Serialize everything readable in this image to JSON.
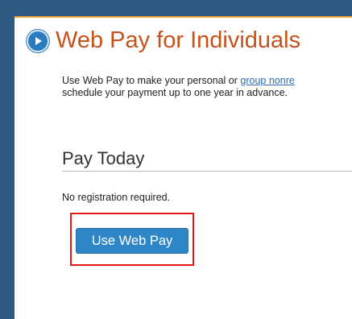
{
  "header": {
    "title": "Web Pay for Individuals",
    "icon": "play-circle-icon"
  },
  "intro": {
    "text_before_link": "Use Web Pay to make your personal or ",
    "link_text": "group nonre",
    "line2": "schedule your payment up to one year in advance."
  },
  "pay_today": {
    "heading": "Pay Today",
    "note": "No registration required.",
    "button_label": "Use Web Pay"
  },
  "colors": {
    "brand_navy": "#2e5a82",
    "accent_orange": "#e8a33d",
    "title_orange": "#c5521b",
    "button_blue": "#2f86c6",
    "link_blue": "#2b6cb0",
    "highlight_red": "#e01818"
  }
}
